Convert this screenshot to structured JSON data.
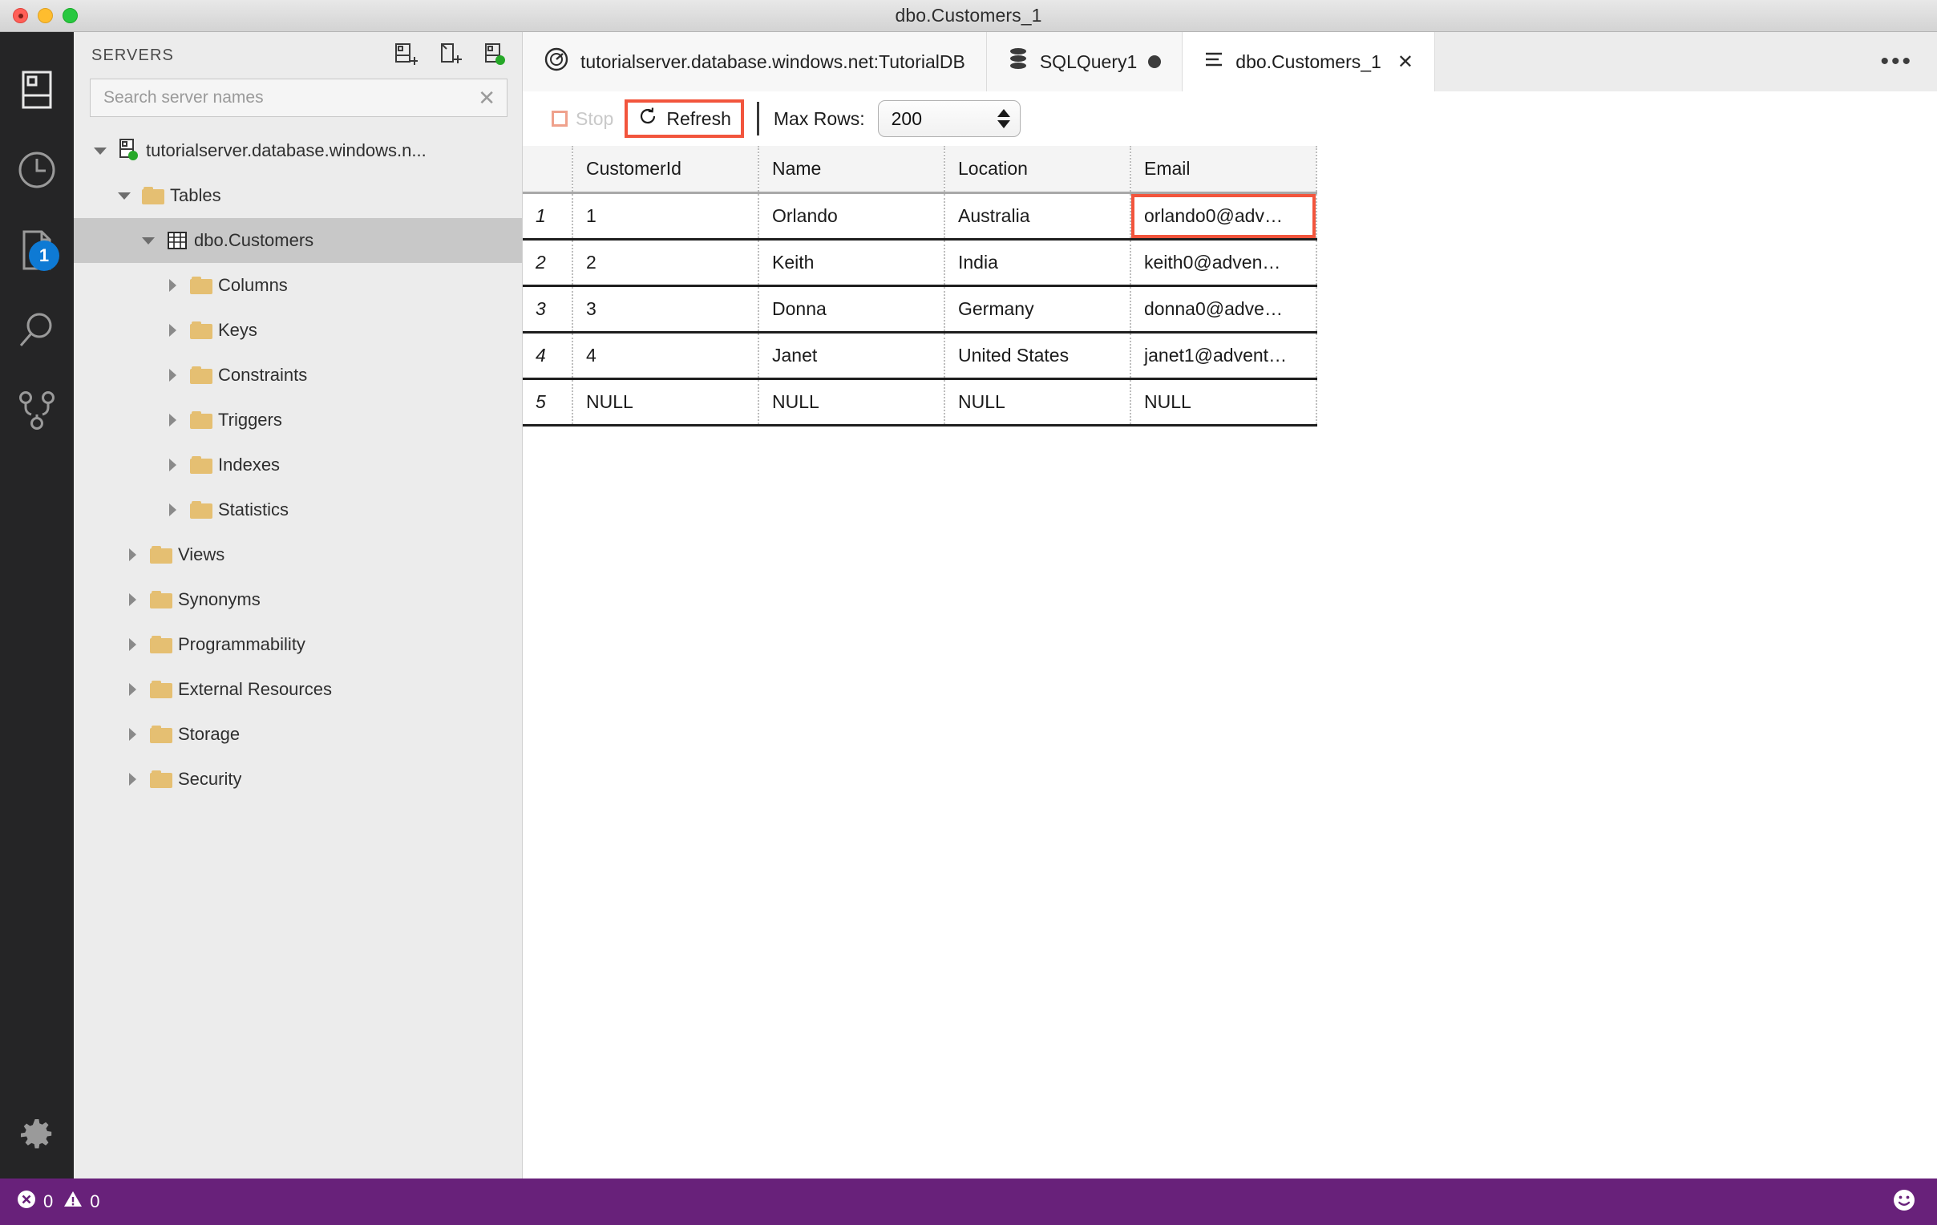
{
  "window": {
    "title": "dbo.Customers_1",
    "traffic_lights": [
      "close",
      "minimize",
      "maximize"
    ]
  },
  "activitybar": {
    "items": [
      {
        "name": "servers-icon",
        "label": "Servers"
      },
      {
        "name": "history-icon",
        "label": "Query History"
      },
      {
        "name": "file-icon",
        "label": "Explorer",
        "badge": "1"
      },
      {
        "name": "search-icon",
        "label": "Search"
      },
      {
        "name": "source-control-icon",
        "label": "Source Control"
      }
    ],
    "bottom": {
      "name": "gear-icon",
      "label": "Manage"
    }
  },
  "sidebar": {
    "title": "SERVERS",
    "actions": [
      {
        "name": "new-connection-icon",
        "label": "New Connection"
      },
      {
        "name": "new-query-icon",
        "label": "New Query"
      },
      {
        "name": "new-server-group-icon",
        "label": "New Server Group"
      }
    ],
    "search": {
      "placeholder": "Search server names",
      "value": "",
      "clear_glyph": "✕"
    },
    "tree": [
      {
        "label": "tutorialserver.database.windows.n...",
        "icon": "server-icon",
        "indent": 0,
        "state": "open",
        "selected": false
      },
      {
        "label": "Tables",
        "icon": "folder-icon",
        "indent": 1,
        "state": "open",
        "selected": false
      },
      {
        "label": "dbo.Customers",
        "icon": "table-icon",
        "indent": 2,
        "state": "open",
        "selected": true
      },
      {
        "label": "Columns",
        "icon": "folder-icon",
        "indent": 3,
        "state": "closed",
        "selected": false
      },
      {
        "label": "Keys",
        "icon": "folder-icon",
        "indent": 3,
        "state": "closed",
        "selected": false
      },
      {
        "label": "Constraints",
        "icon": "folder-icon",
        "indent": 3,
        "state": "closed",
        "selected": false
      },
      {
        "label": "Triggers",
        "icon": "folder-icon",
        "indent": 3,
        "state": "closed",
        "selected": false
      },
      {
        "label": "Indexes",
        "icon": "folder-icon",
        "indent": 3,
        "state": "closed",
        "selected": false
      },
      {
        "label": "Statistics",
        "icon": "folder-icon",
        "indent": 3,
        "state": "closed",
        "selected": false
      },
      {
        "label": "Views",
        "icon": "folder-icon",
        "indent": 2,
        "state": "closed",
        "selected": false
      },
      {
        "label": "Synonyms",
        "icon": "folder-icon",
        "indent": 2,
        "state": "closed",
        "selected": false
      },
      {
        "label": "Programmability",
        "icon": "folder-icon",
        "indent": 2,
        "state": "closed",
        "selected": false
      },
      {
        "label": "External Resources",
        "icon": "folder-icon",
        "indent": 2,
        "state": "closed",
        "selected": false
      },
      {
        "label": "Storage",
        "icon": "folder-icon",
        "indent": 2,
        "state": "closed",
        "selected": false
      },
      {
        "label": "Security",
        "icon": "folder-icon",
        "indent": 2,
        "state": "closed",
        "selected": false
      }
    ]
  },
  "tabs": [
    {
      "label": "tutorialserver.database.windows.net:TutorialDB",
      "icon": "dashboard-icon",
      "state": "inactive",
      "dirty": false,
      "closable": false
    },
    {
      "label": "SQLQuery1",
      "icon": "database-icon",
      "state": "inactive",
      "dirty": true,
      "closable": false
    },
    {
      "label": "dbo.Customers_1",
      "icon": "table-view-icon",
      "state": "current",
      "dirty": false,
      "closable": true
    }
  ],
  "tabbar_overflow": "•••",
  "toolbar": {
    "stop_label": "Stop",
    "stop_enabled": false,
    "refresh_label": "Refresh",
    "refresh_highlighted": true,
    "max_rows_label": "Max Rows:",
    "max_rows_value": "200"
  },
  "grid": {
    "row_number_header": "",
    "columns": [
      "CustomerId",
      "Name",
      "Location",
      "Email"
    ],
    "rows": [
      {
        "n": "1",
        "cells": [
          "1",
          "Orlando",
          "Australia",
          "orlando0@adv…"
        ]
      },
      {
        "n": "2",
        "cells": [
          "2",
          "Keith",
          "India",
          "keith0@adven…"
        ]
      },
      {
        "n": "3",
        "cells": [
          "3",
          "Donna",
          "Germany",
          "donna0@adve…"
        ]
      },
      {
        "n": "4",
        "cells": [
          "4",
          "Janet",
          "United States",
          "janet1@advent…"
        ]
      },
      {
        "n": "5",
        "cells": [
          "NULL",
          "NULL",
          "NULL",
          "NULL"
        ]
      }
    ],
    "selected_cell": {
      "row": 0,
      "col": 3
    }
  },
  "statusbar": {
    "errors_icon": "error-icon",
    "errors_count": "0",
    "warnings_icon": "warning-icon",
    "warnings_count": "0",
    "feedback_icon": "smiley-icon"
  },
  "colors": {
    "accent_highlight": "#f2553d",
    "statusbar_bg": "#68217a",
    "sidebar_bg": "#ececec",
    "activitybar_bg": "#252526",
    "badge_blue": "#0e7ad4",
    "folder_yellow": "#e5bf72",
    "connected_green": "#26a828"
  }
}
